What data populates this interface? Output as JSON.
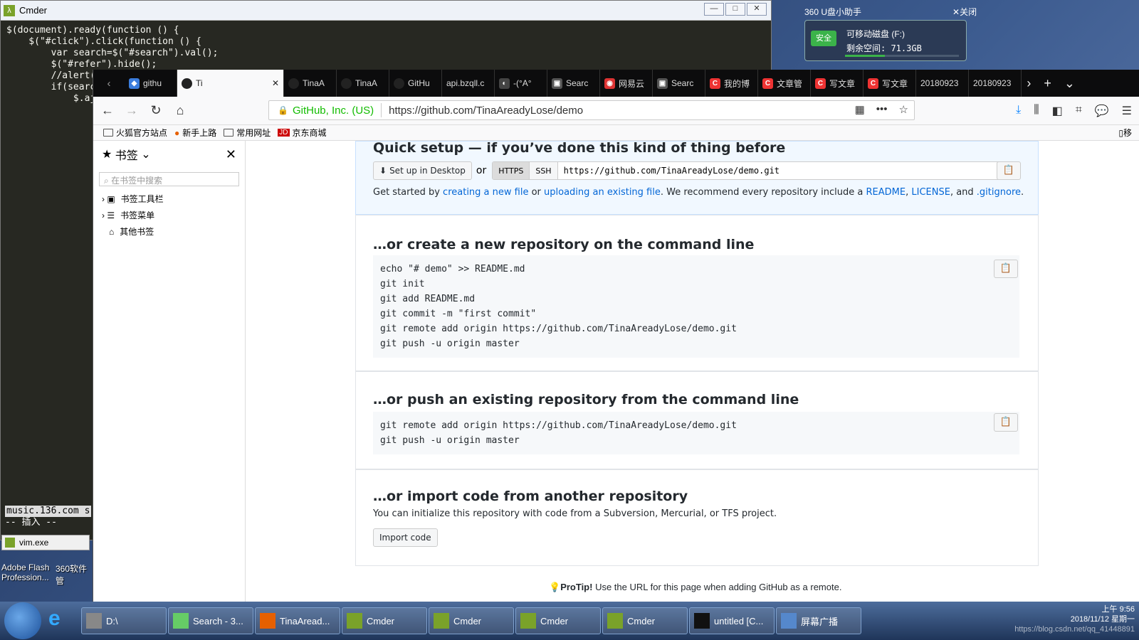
{
  "cmder": {
    "title": "Cmder",
    "code_lines": [
      "$(document).ready(function () {",
      "    $(\"#click\").click(function () {",
      "        var search=$(\"#search\").val();",
      "        $(\"#refer\").hide();",
      "        //alert(s",
      "        if(searc",
      "            $.aj"
    ],
    "status_line": "music.136.com s",
    "mode": "-- 插入 --",
    "task": "vim.exe"
  },
  "desktop_icons": [
    "Adobe Flash Profession...",
    "360软件管"
  ],
  "usb_helper": {
    "title": "360 U盘小助手",
    "close": "关闭",
    "badge": "安全",
    "drive": "可移动磁盘 (F:)",
    "free": "剩余空间: 71.3GB",
    "used_fraction": 0.35
  },
  "firefox": {
    "tabs": [
      "githu",
      "Ti",
      "TinaA",
      "TinaA",
      "GitHu",
      "api.bzqll.c",
      "-(°A°",
      "Searc",
      "网易云",
      "Searc",
      "我的博",
      "文章管",
      "写文章",
      "写文章",
      "20180923",
      "20180923"
    ],
    "active_tab": 1,
    "url_org": "GitHub, Inc. (US)",
    "url": "https://github.com/TinaAreadyLose/demo",
    "bookmarks": [
      "火狐官方站点",
      "新手上路",
      "常用网址",
      "京东商城"
    ],
    "right_edge": "移"
  },
  "sidebar": {
    "title": "书签",
    "search_placeholder": "在书签中搜索",
    "items": [
      "书签工具栏",
      "书签菜单",
      "其他书签"
    ]
  },
  "page": {
    "quick_setup": "Quick setup — if you’ve done this kind of thing before",
    "setup_desktop": "Set up in Desktop",
    "or": "or",
    "https": "HTTPS",
    "ssh": "SSH",
    "clone_url": "https://github.com/TinaAreadyLose/demo.git",
    "get_started_1": "Get started by ",
    "link_new_file": "creating a new file",
    "get_started_2": " or ",
    "link_upload": "uploading an existing file",
    "get_started_3": ". We recommend every repository include a ",
    "link_readme": "README",
    "comma1": ", ",
    "link_license": "LICENSE",
    "and": ", and ",
    "link_gitignore": ".gitignore",
    "dot": ".",
    "new_repo_title": "…or create a new repository on the command line",
    "new_repo_code": "echo \"# demo\" >> README.md\ngit init\ngit add README.md\ngit commit -m \"first commit\"\ngit remote add origin https://github.com/TinaAreadyLose/demo.git\ngit push -u origin master",
    "push_title": "…or push an existing repository from the command line",
    "push_code": "git remote add origin https://github.com/TinaAreadyLose/demo.git\ngit push -u origin master",
    "import_title": "…or import code from another repository",
    "import_desc": "You can initialize this repository with code from a Subversion, Mercurial, or TFS project.",
    "import_btn": "Import code",
    "protip_bold": "ProTip!",
    "protip": " Use the URL for this page when adding GitHub as a remote."
  },
  "taskbar": {
    "items": [
      "D:\\",
      "Search - 3...",
      "TinaAread...",
      "Cmder",
      "Cmder",
      "Cmder",
      "Cmder",
      "untitled [C...",
      "屏幕广播"
    ],
    "time": "上午 9:56",
    "date": "2018/11/12 星期一",
    "watermark": "https://blog.csdn.net/qq_41448891"
  }
}
